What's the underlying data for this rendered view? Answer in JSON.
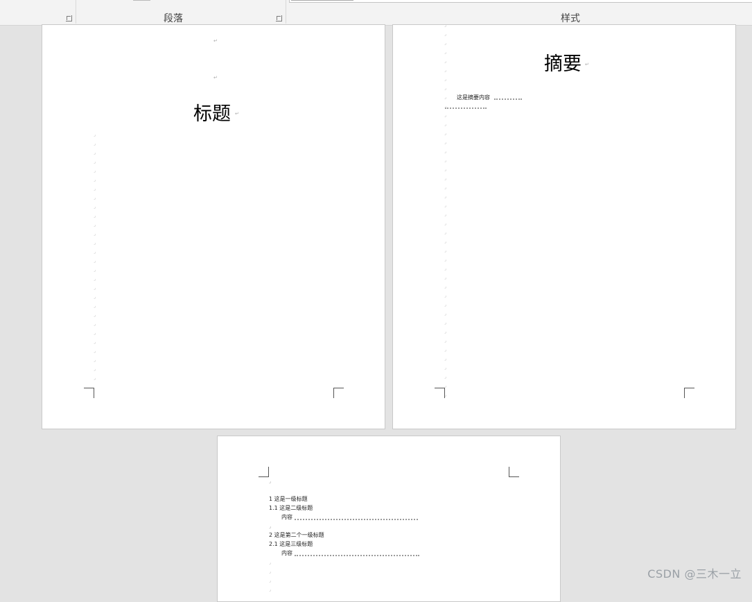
{
  "ribbon": {
    "groups": [
      {
        "label": ""
      },
      {
        "label": "段落"
      },
      {
        "label": "样式"
      }
    ]
  },
  "page1": {
    "title": "标题",
    "para_mark": "↵"
  },
  "page2": {
    "title": "摘要",
    "abstract_text": "这是摘要内容",
    "para_mark": "↵"
  },
  "page3": {
    "toc": [
      {
        "text": "1 这是一级标题"
      },
      {
        "text": "1.1 这是二级标题"
      },
      {
        "text": "内容"
      },
      {
        "text": "2 这是第二个一级标题"
      },
      {
        "text": "2.1 这是三级标题"
      },
      {
        "text": "内容"
      }
    ]
  },
  "watermark": "CSDN @三木一立"
}
